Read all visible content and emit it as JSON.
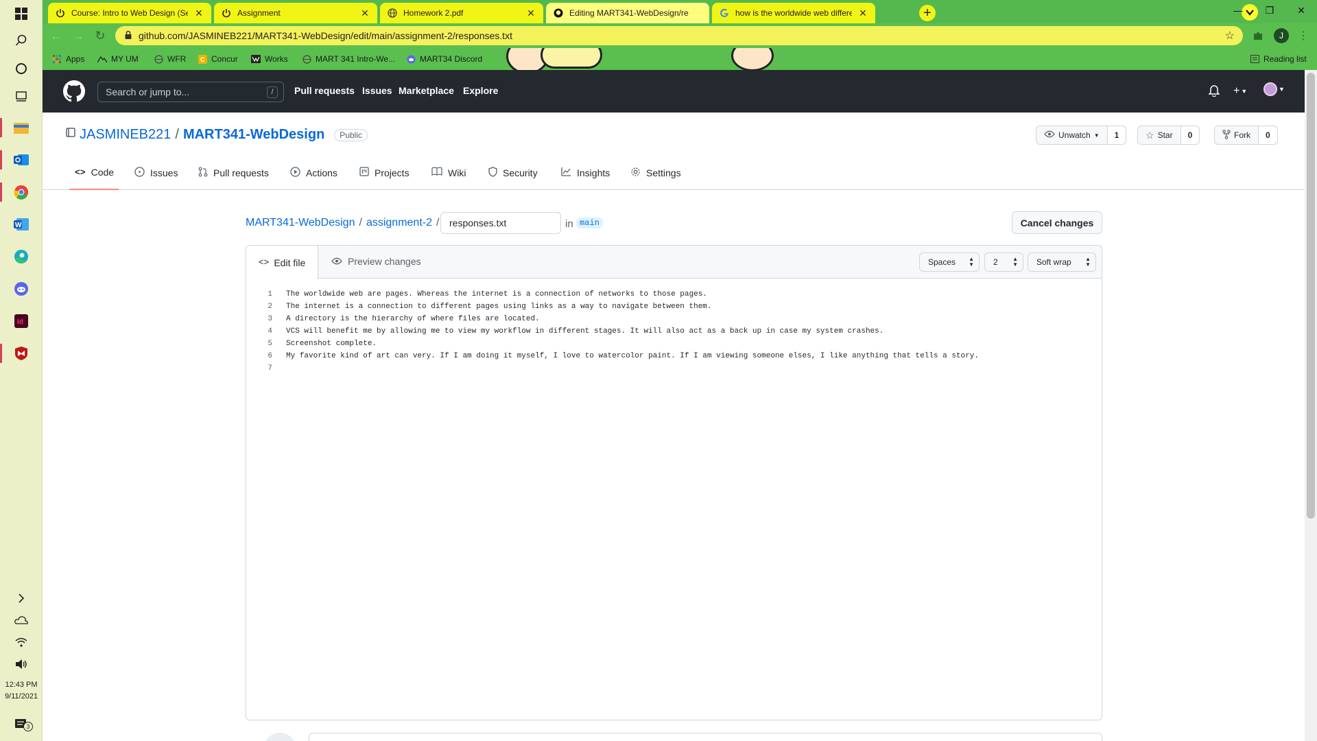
{
  "taskbar": {
    "time": "12:43 PM",
    "date": "9/11/2021",
    "notification_count": "3"
  },
  "tabs": [
    {
      "title": "Course: Intro to Web Design (Se",
      "icon": "power-icon"
    },
    {
      "title": "Assignment",
      "icon": "power-icon"
    },
    {
      "title": "Homework 2.pdf",
      "icon": "globe-icon"
    },
    {
      "title": "Editing MART341-WebDesign/re",
      "icon": "github-icon"
    },
    {
      "title": "how is the worldwide web differe",
      "icon": "google-icon"
    }
  ],
  "address_bar": {
    "url": "github.com/JASMINEB221/MART341-WebDesign/edit/main/assignment-2/responses.txt",
    "profile_initial": "J"
  },
  "bookmarks": {
    "items": [
      "Apps",
      "MY UM",
      "WFR",
      "Concur",
      "Works",
      "MART 341 Intro-We...",
      "MART34 Discord"
    ],
    "reading_list": "Reading list"
  },
  "github_header": {
    "search_placeholder": "Search or jump to...",
    "search_shortcut": "/",
    "nav": [
      "Pull requests",
      "Issues",
      "Marketplace",
      "Explore"
    ]
  },
  "repo": {
    "owner": "JASMINEB221",
    "separator": "/",
    "name": "MART341-WebDesign",
    "visibility": "Public",
    "watch_label": "Unwatch",
    "watch_count": "1",
    "star_label": "Star",
    "star_count": "0",
    "fork_label": "Fork",
    "fork_count": "0",
    "nav": [
      "Code",
      "Issues",
      "Pull requests",
      "Actions",
      "Projects",
      "Wiki",
      "Security",
      "Insights",
      "Settings"
    ]
  },
  "editor": {
    "breadcrumb_repo": "MART341-WebDesign",
    "breadcrumb_sep": "/",
    "breadcrumb_dir": "assignment-2",
    "filename": "responses.txt",
    "in_label": "in",
    "branch": "main",
    "cancel_label": "Cancel changes",
    "edit_tab": "Edit file",
    "preview_tab": "Preview changes",
    "indent_mode": "Spaces",
    "indent_size": "2",
    "wrap_mode": "Soft wrap",
    "lines": [
      {
        "n": "1",
        "text": "The worldwide web are pages. Whereas the internet is a connection of networks to those pages."
      },
      {
        "n": "2",
        "text": "The internet is a connection to different pages using links as a way to navigate between them."
      },
      {
        "n": "3",
        "text": "A directory is the hierarchy of where files are located."
      },
      {
        "n": "4",
        "text": "VCS will benefit me by allowing me to view my workflow in different stages. It will also act as a back up in case my system crashes."
      },
      {
        "n": "5",
        "text": "Screenshot complete."
      },
      {
        "n": "6",
        "text": "My favorite kind of art can very. If I am doing it myself, I love to watercolor paint. If I am viewing someone elses, I like anything that tells a story."
      },
      {
        "n": "7",
        "text": ""
      }
    ]
  },
  "colors": {
    "chrome_frame": "#55b84f",
    "tab_yellow": "#f1f515",
    "github_header": "#24292f",
    "link_blue": "#0969da",
    "active_underline": "#fd8c73"
  }
}
